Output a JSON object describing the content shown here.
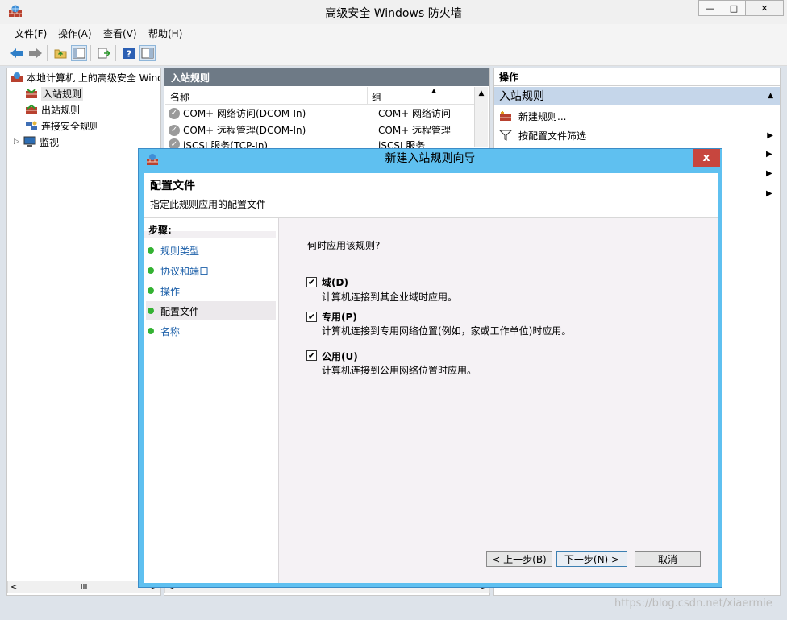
{
  "window": {
    "title": "高级安全 Windows 防火墙",
    "min_glyph": "—",
    "max_glyph": "□",
    "close_glyph": "✕"
  },
  "menu": [
    "文件(F)",
    "操作(A)",
    "查看(V)",
    "帮助(H)"
  ],
  "tree": {
    "root": "本地计算机 上的高级安全 Windows 防火墙",
    "items": [
      "入站规则",
      "出站规则",
      "连接安全规则",
      "监视"
    ],
    "expander": "▷"
  },
  "middle": {
    "header": "入站规则",
    "col_name": "名称",
    "col_group": "组",
    "sort_glyph": "▲",
    "rows": [
      {
        "name": "COM+ 网络访问(DCOM-In)",
        "group": "COM+ 网络访问"
      },
      {
        "name": "COM+ 远程管理(DCOM-In)",
        "group": "COM+ 远程管理"
      },
      {
        "name": "iSCSI 服务(TCP-In)",
        "group": "iSCSI 服务"
      }
    ],
    "check_glyph": "✓"
  },
  "actions": {
    "header": "操作",
    "section": "入站规则",
    "collapse_glyph": "▲",
    "items": [
      {
        "label": "新建规则..."
      },
      {
        "label": "按配置文件筛选"
      }
    ],
    "arrow_glyph": "▶"
  },
  "scroll": {
    "left": "<",
    "right": ">",
    "thumb": "III"
  },
  "dialog": {
    "title": "新建入站规则向导",
    "close_glyph": "x",
    "heading": "配置文件",
    "subheading": "指定此规则应用的配置文件",
    "steps_title": "步骤:",
    "steps": [
      "规则类型",
      "协议和端口",
      "操作",
      "配置文件",
      "名称"
    ],
    "question": "何时应用该规则?",
    "options": [
      {
        "label": "域(D)",
        "desc": "计算机连接到其企业域时应用。",
        "checked": true
      },
      {
        "label": "专用(P)",
        "desc": "计算机连接到专用网络位置(例如，家或工作单位)时应用。",
        "checked": true
      },
      {
        "label": "公用(U)",
        "desc": "计算机连接到公用网络位置时应用。",
        "checked": true
      }
    ],
    "check_mark": "✔",
    "back_button": "< 上一步(B)",
    "next_button": "下一步(N) >",
    "cancel_button": "取消"
  },
  "watermark": "https://blog.csdn.net/xiaermie"
}
